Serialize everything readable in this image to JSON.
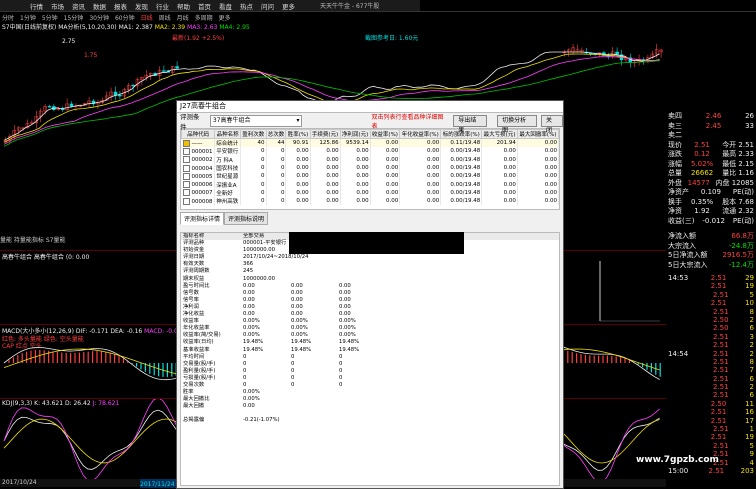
{
  "topbar": {
    "menu": [
      "行情",
      "市场",
      "资讯",
      "数据",
      "报表",
      "发现",
      "行业",
      "帮助",
      "首页",
      "看盘",
      "热点",
      "问问",
      "更多"
    ],
    "title": "天天牛牛金 - 677牛股"
  },
  "periods": [
    "分时",
    "1分钟",
    "5分钟",
    "15分钟",
    "30分钟",
    "60分钟",
    "日线",
    "周线",
    "月线",
    "多周期",
    "更多"
  ],
  "active_period": "日线",
  "price_chart": {
    "title": "S7中国(日线前复权)",
    "ma_labels": [
      "MA分析(5,10,20,30)",
      "MA1: 2.387",
      "MA2: 2.39",
      "MA3: 2.63",
      "MA4: 2.95",
      "MA5: 2.51"
    ],
    "note_left": "2.75",
    "note_red": "1.75",
    "note_tag": "最高: 2.990",
    "note_tag2": "最新(1.92 +2.5%)",
    "signal_red": "2.68",
    "right_anno": "截图参考日: 1.60元"
  },
  "vol_chart": {
    "label": "量能  持量能指标  S7量能",
    "indicator": "高春牛组合  高春牛组合 (0: 0.00"
  },
  "macd": {
    "label": "MACD(大小多小(12,26,9) DIF: -0.171  DEA: -0.16",
    "macd_val": "MACD: -0.02",
    "note1": "红色: 多头量能 绿色: 空头量能",
    "note2": "CAP 红点 空头"
  },
  "kdj": {
    "label": "KDJ(9,3,3) K: 43.621 D: 26.42",
    "j_val": "J: 78.621"
  },
  "bottom_date": "2017/10/24",
  "bottom_date2": "2017/11/24 (五)",
  "dialog": {
    "title": "J27高春牛组合",
    "condition_label": "评测条件",
    "condition_value": "37高春牛组合",
    "tip": "双击列表行查看品种详细图表",
    "export_btn": "导出结果",
    "switch_btn": "切换分析图",
    "close_btn": "关闭",
    "columns": [
      "品种代码",
      "品种名称",
      "盈利次数",
      "总次数",
      "胜率(%)",
      "手续费(元)",
      "净利润(元)",
      "收益率(%)",
      "年化收益率(%)",
      "标的涨跌率(%)",
      "最大亏损(元)",
      "最大回撤率(%)"
    ],
    "rows": [
      {
        "code": "——",
        "name": "综合统计",
        "win": "40",
        "total": "44",
        "rate": "90.91",
        "fee": "125.86",
        "profit": "9539.14",
        "ret": "0.00",
        "annual": "0.00",
        "bench": "0.11/19.48",
        "maxloss": "201.94",
        "dd": "0.00"
      },
      {
        "code": "000001",
        "name": "平安银行",
        "win": "0",
        "total": "0",
        "rate": "0.00",
        "fee": "0.00",
        "profit": "0.00",
        "ret": "0.00",
        "annual": "0.00",
        "bench": "0.00/19.48",
        "maxloss": "0.00",
        "dd": "0.00"
      },
      {
        "code": "000002",
        "name": "万 科A",
        "win": "0",
        "total": "0",
        "rate": "0.00",
        "fee": "0.00",
        "profit": "0.00",
        "ret": "0.00",
        "annual": "0.00",
        "bench": "0.00/19.48",
        "maxloss": "0.00",
        "dd": "0.00"
      },
      {
        "code": "000004",
        "name": "国农科技",
        "win": "0",
        "total": "0",
        "rate": "0.00",
        "fee": "0.00",
        "profit": "0.00",
        "ret": "0.00",
        "annual": "0.00",
        "bench": "0.00/19.48",
        "maxloss": "0.00",
        "dd": "0.00"
      },
      {
        "code": "000005",
        "name": "世纪星源",
        "win": "0",
        "total": "0",
        "rate": "0.00",
        "fee": "0.00",
        "profit": "0.00",
        "ret": "0.00",
        "annual": "0.00",
        "bench": "0.00/19.48",
        "maxloss": "0.00",
        "dd": "0.00"
      },
      {
        "code": "000006",
        "name": "深振业A",
        "win": "0",
        "total": "0",
        "rate": "0.00",
        "fee": "0.00",
        "profit": "0.00",
        "ret": "0.00",
        "annual": "0.00",
        "bench": "0.00/19.48",
        "maxloss": "0.00",
        "dd": "0.00"
      },
      {
        "code": "000007",
        "name": "全新好",
        "win": "0",
        "total": "0",
        "rate": "0.00",
        "fee": "0.00",
        "profit": "0.00",
        "ret": "0.00",
        "annual": "0.00",
        "bench": "0.00/19.48",
        "maxloss": "0.00",
        "dd": "0.00"
      },
      {
        "code": "000008",
        "name": "神州高铁",
        "win": "0",
        "total": "0",
        "rate": "0.00",
        "fee": "0.00",
        "profit": "0.00",
        "ret": "0.00",
        "annual": "0.00",
        "bench": "0.00/19.48",
        "maxloss": "0.00",
        "dd": "0.00"
      }
    ],
    "tabs": [
      "评测指标详情",
      "评测指标说明"
    ],
    "detail_header": [
      "指标名称",
      "全部交易",
      "多头",
      "空头"
    ],
    "detail_rows": [
      [
        "评测品种",
        "000001-平安银行",
        "",
        ""
      ],
      [
        "初始资金",
        "1000000.00",
        "",
        ""
      ],
      [
        "评测日期",
        "2017/10/24~2018/10/24",
        "",
        ""
      ],
      [
        "有效天数",
        "366",
        "",
        ""
      ],
      [
        "评测周期数",
        "245",
        "",
        ""
      ],
      [
        "期末权益",
        "1000000.00",
        "",
        ""
      ],
      [
        "盈亏时间比",
        "0.00",
        "0.00",
        "0.00"
      ],
      [
        "信号数",
        "0.00",
        "0.00",
        "0.00"
      ],
      [
        "信号率",
        "0.00",
        "0.00",
        "0.00"
      ],
      [
        "净利润",
        "0.00",
        "0.00",
        "0.00"
      ],
      [
        "净化收益",
        "0.00",
        "0.00",
        "0.00"
      ],
      [
        "收益率",
        "0.00%",
        "0.00%",
        "0.00%"
      ],
      [
        "年化收益率",
        "0.00%",
        "0.00%",
        "0.00%"
      ],
      [
        "收益率(简/交易)",
        "0.00%",
        "0.00%",
        "0.00%"
      ],
      [
        "收益率(日均)",
        "19.48%",
        "19.48%",
        "19.48%"
      ],
      [
        "基准收益率",
        "19.48%",
        "19.48%",
        "19.48%"
      ],
      [
        "平均时间",
        "0",
        "0",
        "0"
      ],
      [
        "交易量(股/手)",
        "0",
        "0",
        "0"
      ],
      [
        "盈利量(股/手)",
        "0",
        "0",
        "0"
      ],
      [
        "亏损量(股/手)",
        "0",
        "0",
        "0"
      ],
      [
        "交易次数",
        "0",
        "0",
        "0"
      ],
      [
        "胜率",
        "0.00%",
        "",
        ""
      ],
      [
        "最大回撤比",
        "0.00%",
        "",
        ""
      ],
      [
        "最大回撤",
        "0.00",
        "",
        ""
      ],
      [
        "",
        "",
        "",
        ""
      ],
      [
        "总揭露偏",
        "-0.21(-1.07%)",
        "",
        ""
      ]
    ]
  },
  "quote_panel": {
    "rows": [
      {
        "k": "卖四",
        "v": "2.46",
        "v2": "26",
        "c": "red"
      },
      {
        "k": "卖三",
        "v": "2.45",
        "v2": "33",
        "c": "red"
      },
      {
        "k": "卖二",
        "v": "",
        "v2": "",
        "c": "red"
      },
      {
        "k": "现价",
        "v": "2.51",
        "v2": "今开 2.51",
        "c": "red"
      },
      {
        "k": "涨跌",
        "v": "0.12",
        "v2": "最高 2.33",
        "c": "red"
      },
      {
        "k": "涨幅",
        "v": "5.02%",
        "v2": "最低 2.15",
        "c": "red"
      },
      {
        "k": "总量",
        "v": "26662",
        "v2": "量比 1.16",
        "c": "yellow"
      },
      {
        "k": "外盘",
        "v": "14577",
        "v2": "内盘 12085",
        "c": "red"
      },
      {
        "k": "净资产",
        "v": "0.109",
        "v2": "PE(动) ",
        "c": "white"
      },
      {
        "k": "换手",
        "v": "0.35%",
        "v2": "股本 7.68",
        "c": "white"
      },
      {
        "k": "净资",
        "v": "1.92",
        "v2": "流通 2.32",
        "c": "white"
      },
      {
        "k": "收益(三)",
        "v": "-0.012",
        "v2": "PE(动) ",
        "c": "white"
      }
    ],
    "flow": [
      {
        "k": "净流入额",
        "v": "66.8万",
        "c": "red"
      },
      {
        "k": "大宗流入",
        "v": "-24.8万",
        "c": "green"
      },
      {
        "k": "5日净流入额",
        "v": "2916.5万",
        "c": "red"
      },
      {
        "k": "5日大宗流入",
        "v": "-12.4万",
        "c": "green"
      }
    ],
    "ticks": [
      {
        "t": "14:53",
        "p": "2.51",
        "v": "29"
      },
      {
        "t": "",
        "p": "2.51",
        "v": "19"
      },
      {
        "t": "",
        "p": "2.51",
        "v": "5"
      },
      {
        "t": "",
        "p": "2.51",
        "v": "10"
      },
      {
        "t": "",
        "p": "2.51",
        "v": "8"
      },
      {
        "t": "",
        "p": "2.50",
        "v": "2"
      },
      {
        "t": "",
        "p": "2.50",
        "v": "6"
      },
      {
        "t": "",
        "p": "2.51",
        "v": "3"
      },
      {
        "t": "",
        "p": "2.51",
        "v": "2"
      },
      {
        "t": "14:54",
        "p": "2.51",
        "v": "2"
      },
      {
        "t": "",
        "p": "2.51",
        "v": "8"
      },
      {
        "t": "",
        "p": "2.51",
        "v": "7"
      },
      {
        "t": "",
        "p": "2.51",
        "v": "6"
      },
      {
        "t": "",
        "p": "2.51",
        "v": "2"
      },
      {
        "t": "",
        "p": "2.51",
        "v": "6"
      },
      {
        "t": "",
        "p": "2.50",
        "v": "11"
      },
      {
        "t": "",
        "p": "2.51",
        "v": "16"
      },
      {
        "t": "",
        "p": "2.51",
        "v": "17"
      },
      {
        "t": "",
        "p": "2.51",
        "v": "1"
      },
      {
        "t": "",
        "p": "2.51",
        "v": "19"
      },
      {
        "t": "",
        "p": "2.51",
        "v": "5"
      },
      {
        "t": "",
        "p": "2.51",
        "v": "9"
      },
      {
        "t": "",
        "p": "2.51",
        "v": "4"
      },
      {
        "t": "15:00",
        "p": "2.51",
        "v": "203"
      }
    ]
  },
  "right_price_labels": [
    "2.46",
    "2.45",
    "2.43",
    "2.41",
    "2.40"
  ],
  "watermark": "www.7gpzb.com"
}
